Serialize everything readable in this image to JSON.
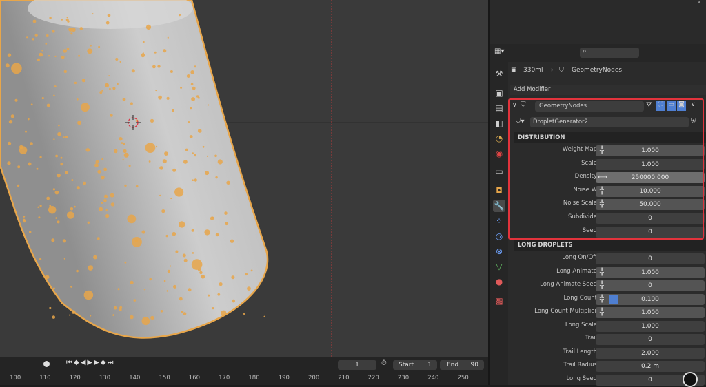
{
  "breadcrumb": {
    "object": "330ml",
    "modifier": "GeometryNodes"
  },
  "add_modifier_label": "Add Modifier",
  "modifier": {
    "name": "GeometryNodes",
    "node_group": "DropletGenerator2"
  },
  "sections": {
    "distribution": "DISTRIBUTION",
    "long_droplets": "LONG DROPLETS"
  },
  "distribution_rows": [
    {
      "label": "Weight Map",
      "value": "1.000",
      "icon": true
    },
    {
      "label": "Scale",
      "value": "1.000",
      "icon": false
    },
    {
      "label": "Density",
      "value": "250000.000",
      "icon": false
    },
    {
      "label": "Noise W",
      "value": "10.000",
      "icon": true
    },
    {
      "label": "Noise Scale",
      "value": "50.000",
      "icon": true
    },
    {
      "label": "Subdivide",
      "value": "0",
      "icon": false
    },
    {
      "label": "Seed",
      "value": "0",
      "icon": false
    }
  ],
  "long_rows": [
    {
      "label": "Long On/Off",
      "value": "0",
      "icon": false
    },
    {
      "label": "Long Animate",
      "value": "1.000",
      "icon": true
    },
    {
      "label": "Long Animate Seed",
      "value": "0",
      "icon": true
    },
    {
      "label": "Long Count",
      "value": "0.100",
      "icon": true
    },
    {
      "label": "Long Count Multiplier",
      "value": "1.000",
      "icon": true
    },
    {
      "label": "Long Scale",
      "value": "1.000",
      "icon": false
    },
    {
      "label": "Trail",
      "value": "0",
      "icon": false
    },
    {
      "label": "Trail Length",
      "value": "2.000",
      "icon": false
    },
    {
      "label": "Trail Radius",
      "value": "0.2 m",
      "icon": false
    },
    {
      "label": "Long Seed",
      "value": "0",
      "icon": false
    }
  ],
  "long_count_fill": 0.1,
  "timeline": {
    "current_frame": "1",
    "start_label": "Start",
    "start_value": "1",
    "end_label": "End",
    "end_value": "90",
    "ticks": [
      "100",
      "110",
      "120",
      "130",
      "140",
      "150",
      "160",
      "170",
      "180",
      "190",
      "200",
      "210",
      "220",
      "230",
      "240",
      "250"
    ]
  },
  "colors": {
    "highlight": "#e2333c",
    "selection_orange": "#e8a64a",
    "accent_blue": "#4f7fd1"
  }
}
